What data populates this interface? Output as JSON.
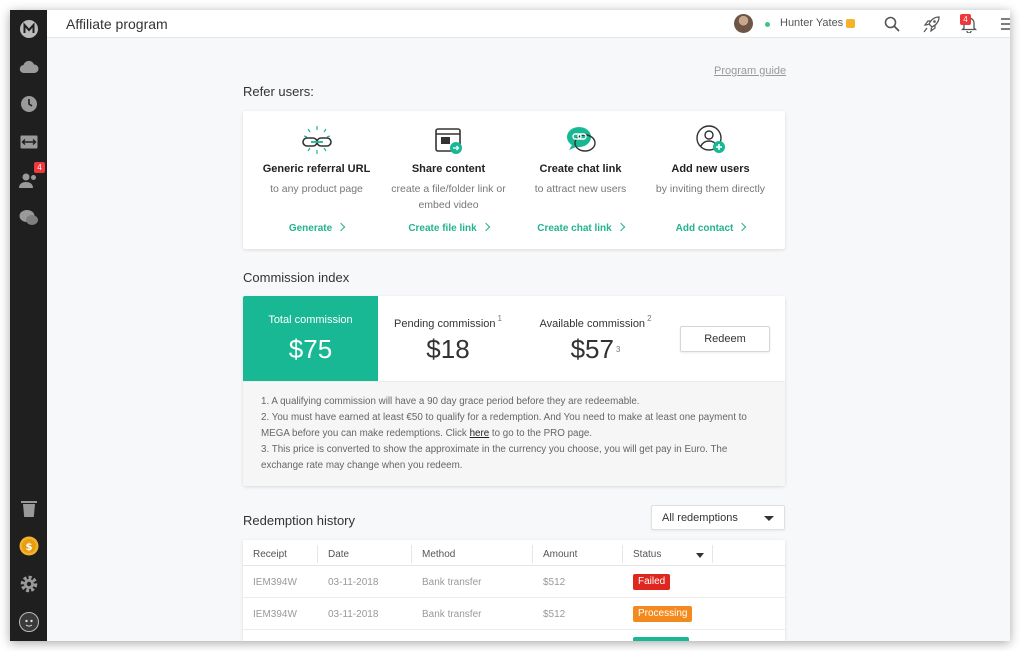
{
  "app": {
    "page_title": "Affiliate program",
    "colors": {
      "accent": "#18b894",
      "link": "#23b38f",
      "danger": "#e0271f",
      "warning": "#f48a1e"
    }
  },
  "header": {
    "user_name": "Hunter Yates",
    "notification_count": "4",
    "icons": [
      "search-icon",
      "rocket-icon",
      "bell-icon",
      "menu-icon"
    ]
  },
  "sidebar": {
    "icons": [
      "mega-logo-icon",
      "cloud-icon",
      "clock-icon",
      "transfer-icon",
      "contacts-icon",
      "chat-icon",
      "trash-icon",
      "coin-icon",
      "gear-icon",
      "avatar-icon"
    ],
    "contacts_badge": "4"
  },
  "program_guide": "Program guide",
  "refer": {
    "section_title": "Refer users:",
    "items": [
      {
        "title": "Generic referral URL",
        "desc": "to any product page",
        "link": "Generate"
      },
      {
        "title": "Share content",
        "desc": "create a file/folder link or embed video",
        "link": "Create file link"
      },
      {
        "title": "Create chat link",
        "desc": "to attract new users",
        "link": "Create chat link"
      },
      {
        "title": "Add new users",
        "desc": "by inviting them directly",
        "link": "Add contact"
      }
    ]
  },
  "commission": {
    "section_title": "Commission index",
    "total_label": "Total commission",
    "total_value": "$75",
    "pending_label": "Pending commission",
    "pending_sup": "1",
    "pending_value": "$18",
    "available_label": "Available commission",
    "available_sup": "2",
    "available_value": "$57",
    "available_value_sup": "3",
    "redeem_label": "Redeem",
    "note1": "1.  A qualifying commission will have a 90 day grace period before they are redeemable.",
    "note2a": "2.  You must have earned at least €50 to qualify for a redemption.  And You need to make at least one payment to MEGA before you can make redemptions. Click ",
    "note2_link": "here",
    "note2b": " to go to the PRO page.",
    "note3": "3. This price is converted to show the approximate in the currency you choose, you will get pay in Euro. The exchange rate may change when you redeem."
  },
  "redemption": {
    "section_title": "Redemption history",
    "filter_value": "All redemptions",
    "columns": [
      "Receipt",
      "Date",
      "Method",
      "Amount",
      "Status"
    ],
    "rows": [
      {
        "receipt": "IEM394W",
        "date": "03-11-2018",
        "method": "Bank transfer",
        "amount": "$512",
        "status": "Failed"
      },
      {
        "receipt": "IEM394W",
        "date": "03-11-2018",
        "method": "Bank transfer",
        "amount": "$512",
        "status": "Processing"
      }
    ]
  }
}
